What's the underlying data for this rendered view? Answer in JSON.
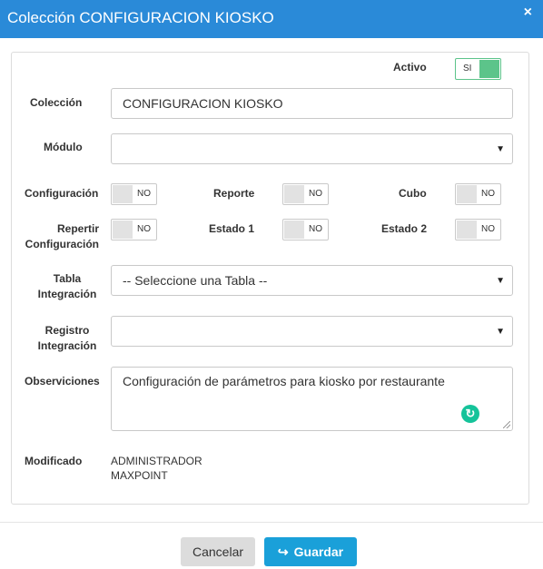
{
  "dialog": {
    "title": "Colección CONFIGURACION KIOSKO",
    "close_label": "×"
  },
  "form": {
    "activo_label": "Activo",
    "activo_toggle": "SI",
    "coleccion_label": "Colección",
    "coleccion_value": "CONFIGURACION KIOSKO",
    "modulo_label": "Módulo",
    "modulo_value": "",
    "configuracion_label": "Configuración",
    "configuracion_toggle": "NO",
    "reporte_label": "Reporte",
    "reporte_toggle": "NO",
    "cubo_label": "Cubo",
    "cubo_toggle": "NO",
    "repertir_label_1": "Repertir",
    "repertir_label_2": "Configuración",
    "repertir_toggle": "NO",
    "estado1_label": "Estado 1",
    "estado1_toggle": "NO",
    "estado2_label": "Estado 2",
    "estado2_toggle": "NO",
    "tabla_label_1": "Tabla",
    "tabla_label_2": "Integración",
    "tabla_value": "-- Seleccione una Tabla --",
    "registro_label_1": "Registro",
    "registro_label_2": "Integración",
    "registro_value": "",
    "observaciones_label": "Observiciones",
    "observaciones_value": "Configuración de parámetros para kiosko por restaurante",
    "modificado_label": "Modificado",
    "modificado_value_1": "ADMINISTRADOR",
    "modificado_value_2": "MAXPOINT"
  },
  "footer": {
    "cancel_label": "Cancelar",
    "save_label": "Guardar"
  },
  "colors": {
    "header": "#2a8ad8",
    "toggle_on": "#5cc48a",
    "save_button": "#1aa0d9",
    "grammarly": "#15c39a"
  },
  "icons": {
    "close": "close-icon",
    "save": "save-icon",
    "dropdown": "caret-down-icon",
    "grammarly": "grammarly-icon"
  }
}
